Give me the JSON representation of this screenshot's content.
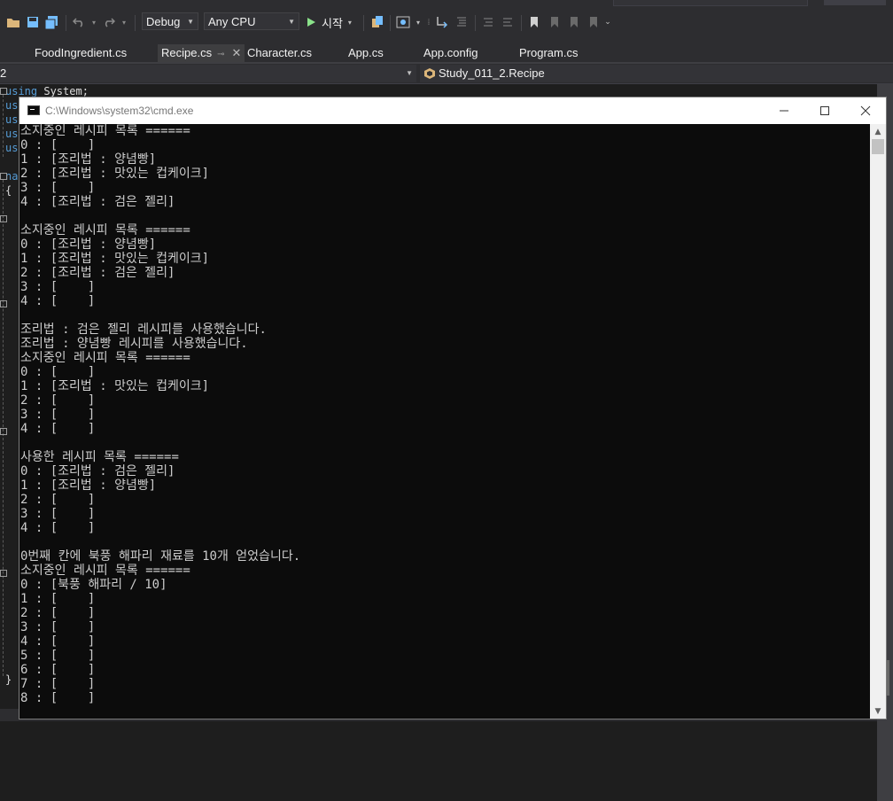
{
  "toolbar": {
    "config": "Debug",
    "platform": "Any CPU",
    "start_label": "시작"
  },
  "tabs": [
    {
      "label": "FoodIngredient.cs"
    },
    {
      "label": "Recipe.cs"
    },
    {
      "label": "Character.cs"
    },
    {
      "label": "App.cs"
    },
    {
      "label": "App.config"
    },
    {
      "label": "Program.cs"
    }
  ],
  "navbar": {
    "project": "2",
    "member": "Study_011_2.Recipe"
  },
  "editor": {
    "line1_keyword": "using",
    "line1_rest": " System;",
    "fragments": [
      "us",
      "us",
      "us",
      "us",
      "na",
      "{",
      "}"
    ]
  },
  "cmd": {
    "title": "C:\\Windows\\system32\\cmd.exe",
    "lines": [
      "소지중인 레시피 목록 ======",
      "0 : [    ]",
      "1 : [조리법 : 양념빵]",
      "2 : [조리법 : 맛있는 컵케이크]",
      "3 : [    ]",
      "4 : [조리법 : 검은 젤리]",
      "",
      "소지중인 레시피 목록 ======",
      "0 : [조리법 : 양념빵]",
      "1 : [조리법 : 맛있는 컵케이크]",
      "2 : [조리법 : 검은 젤리]",
      "3 : [    ]",
      "4 : [    ]",
      "",
      "조리법 : 검은 젤리 레시피를 사용했습니다.",
      "조리법 : 양념빵 레시피를 사용했습니다.",
      "소지중인 레시피 목록 ======",
      "0 : [    ]",
      "1 : [조리법 : 맛있는 컵케이크]",
      "2 : [    ]",
      "3 : [    ]",
      "4 : [    ]",
      "",
      "사용한 레시피 목록 ======",
      "0 : [조리법 : 검은 젤리]",
      "1 : [조리법 : 양념빵]",
      "2 : [    ]",
      "3 : [    ]",
      "4 : [    ]",
      "",
      "0번째 칸에 북풍 해파리 재료를 10개 얻었습니다.",
      "소지중인 레시피 목록 ======",
      "0 : [북풍 해파리 / 10]",
      "1 : [    ]",
      "2 : [    ]",
      "3 : [    ]",
      "4 : [    ]",
      "5 : [    ]",
      "6 : [    ]",
      "7 : [    ]",
      "8 : [    ]"
    ]
  }
}
